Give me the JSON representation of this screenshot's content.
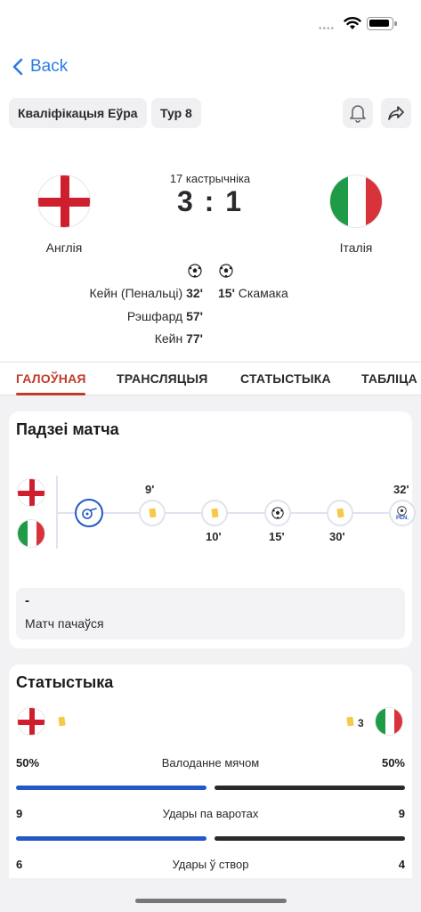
{
  "nav": {
    "back_label": "Back"
  },
  "header": {
    "competition": "Кваліфікацыя Еўра",
    "round": "Тур 8",
    "bell_icon": "bell-icon",
    "share_icon": "share-icon"
  },
  "match": {
    "date": "17 кастрычніка",
    "score": "3 : 1",
    "home_team": "Англія",
    "away_team": "Італія",
    "home_scorers": [
      {
        "name": "Кейн (Пенальці)",
        "minute": "32'"
      },
      {
        "name": "Рэшфард",
        "minute": "57'"
      },
      {
        "name": "Кейн",
        "minute": "77'"
      }
    ],
    "away_scorers": [
      {
        "minute": "15'",
        "name": "Скамака"
      }
    ]
  },
  "tabs": [
    "ГАЛОЎНАЯ",
    "ТРАНСЛЯЦЫЯ",
    "СТАТЫСТЫКА",
    "ТАБЛІЦА"
  ],
  "events": {
    "title": "Падзеі матча",
    "timeline": [
      {
        "type": "kickoff",
        "minute": ""
      },
      {
        "type": "yellow-card",
        "minute": "9'",
        "team": "home"
      },
      {
        "type": "yellow-card",
        "minute": "10'",
        "team": "away"
      },
      {
        "type": "goal",
        "minute": "15'",
        "team": "away"
      },
      {
        "type": "yellow-card",
        "minute": "30'",
        "team": "away"
      },
      {
        "type": "penalty-goal",
        "minute": "32'",
        "team": "home",
        "tag": "PEN."
      }
    ],
    "detail_dash": "-",
    "detail_text": "Матч пачаўся"
  },
  "stats": {
    "title": "Статыстыка",
    "home_yellow_count": "",
    "away_yellow_count": "3",
    "rows": [
      {
        "label": "Валоданне мячом",
        "home": "50%",
        "away": "50%"
      },
      {
        "label": "Удары па варотах",
        "home": "9",
        "away": "9"
      },
      {
        "label": "Удары ў створ",
        "home": "6",
        "away": "4"
      }
    ]
  },
  "colors": {
    "accent": "#c13b2c",
    "link": "#2c7be5",
    "home_bar": "#2458c6",
    "away_bar": "#2a2a2e",
    "yellow_card": "#f7c948"
  }
}
